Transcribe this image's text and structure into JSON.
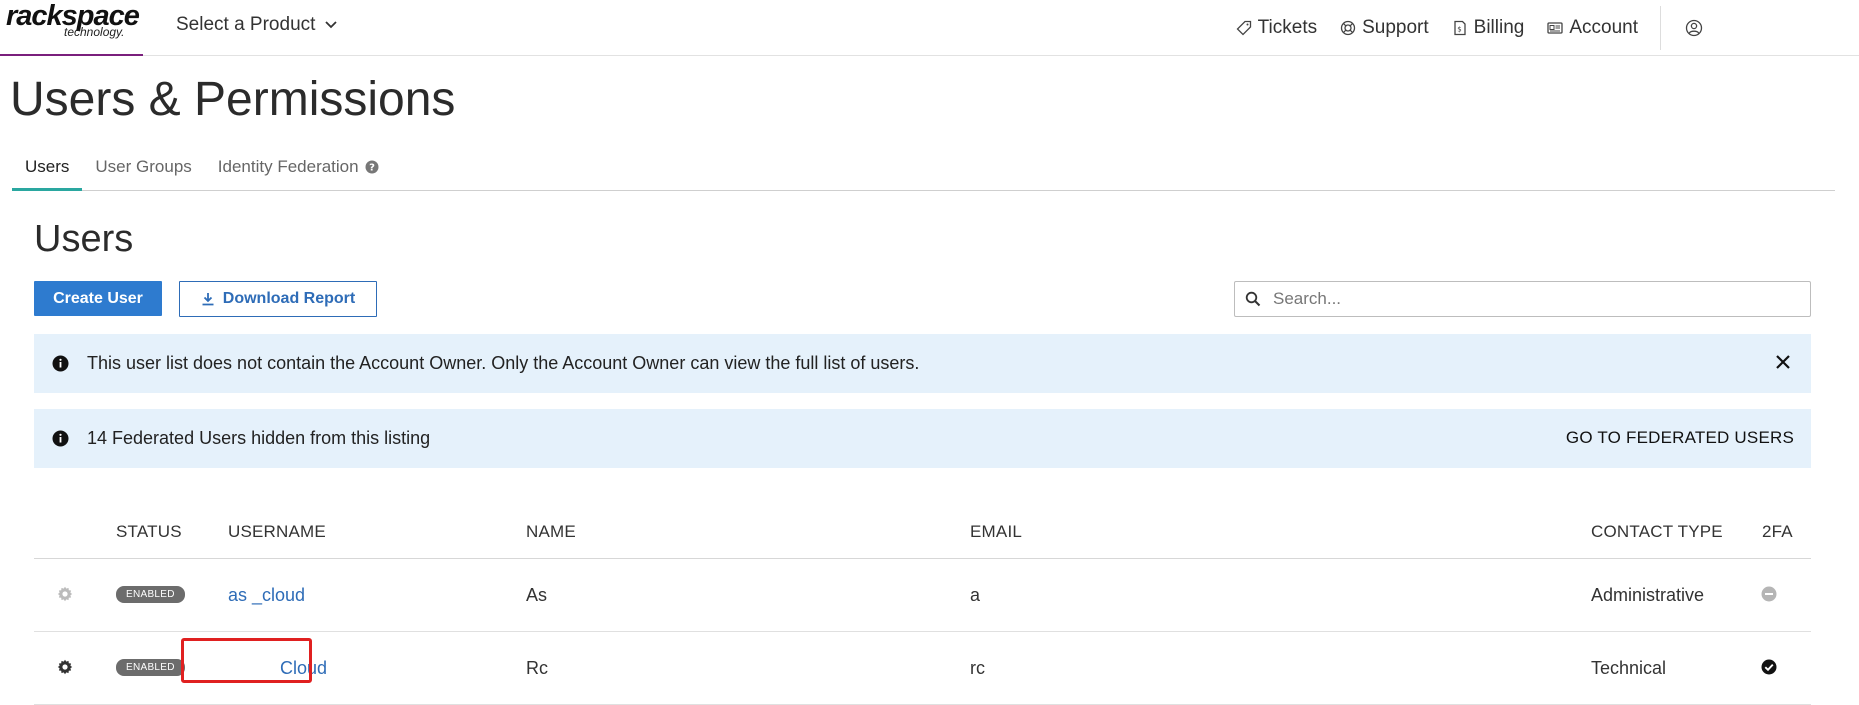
{
  "brand": {
    "logo_main": "rackspace",
    "logo_sub": "technology."
  },
  "topnav": {
    "product_select": "Select a Product",
    "links": [
      {
        "label": "Tickets",
        "icon": "tag-icon"
      },
      {
        "label": "Support",
        "icon": "lifebuoy-icon"
      },
      {
        "label": "Billing",
        "icon": "invoice-icon"
      },
      {
        "label": "Account",
        "icon": "id-card-icon"
      }
    ],
    "user_icon": "user-circle-icon"
  },
  "page": {
    "title": "Users & Permissions"
  },
  "tabs": [
    {
      "label": "Users",
      "active": true
    },
    {
      "label": "User Groups",
      "active": false
    },
    {
      "label": "Identity Federation",
      "active": false,
      "icon": "help-circle-icon"
    }
  ],
  "section": {
    "title": "Users",
    "create_label": "Create User",
    "download_label": "Download Report",
    "search_placeholder": "Search..."
  },
  "alerts": {
    "owner_notice": "This user list does not contain the Account Owner. Only the Account Owner can view the full list of users.",
    "federated_notice": "14 Federated Users hidden from this listing",
    "federated_link": "GO TO FEDERATED USERS"
  },
  "table": {
    "headers": [
      "STATUS",
      "USERNAME",
      "NAME",
      "EMAIL",
      "CONTACT TYPE",
      "2FA"
    ],
    "rows": [
      {
        "status": "ENABLED",
        "username": "as        _cloud",
        "name": "As",
        "email": "a",
        "contact_type": "Administrative",
        "twofa": "disabled"
      },
      {
        "status": "ENABLED",
        "username": "Cloud",
        "name": "Rc",
        "email": "rc",
        "contact_type": "Technical",
        "twofa": "enabled"
      }
    ]
  },
  "colors": {
    "primary": "#2e7bcf",
    "link": "#2e6cb7",
    "tab_active": "#2aa7a0",
    "alert_bg": "#e5f1fb",
    "brand_underline": "#7a1f7c",
    "highlight": "#e02020"
  }
}
